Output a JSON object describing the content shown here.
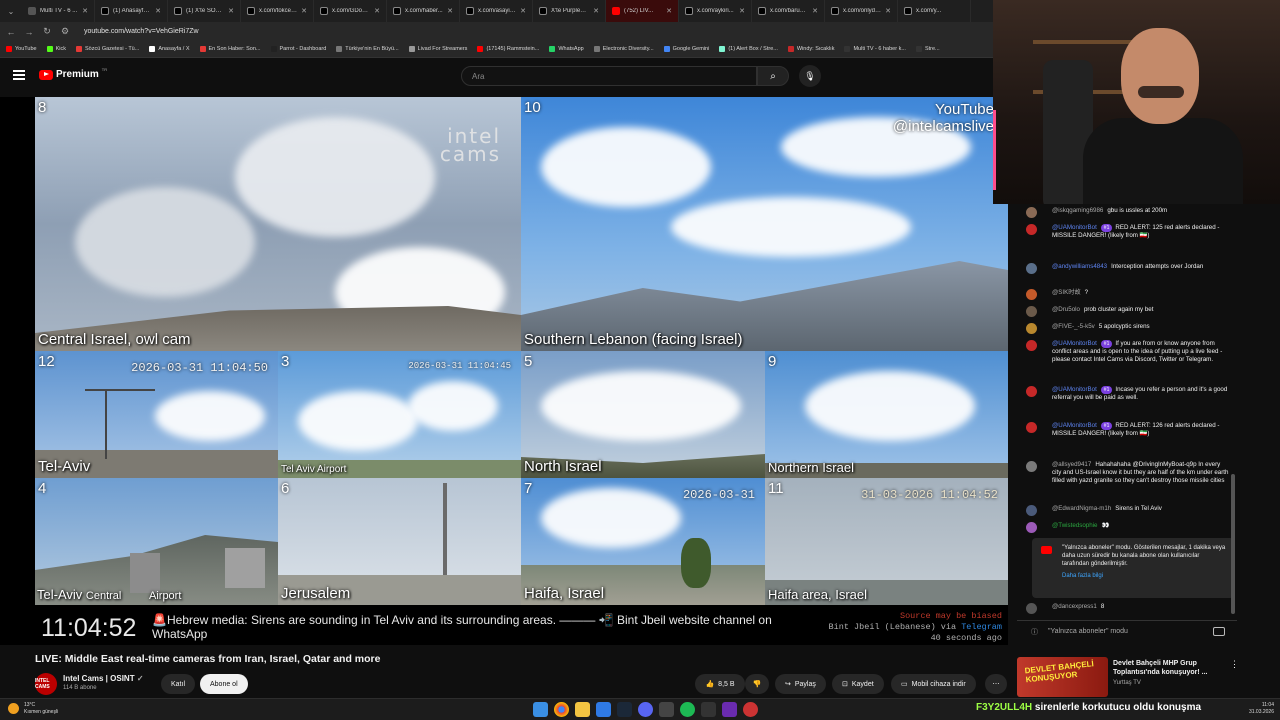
{
  "browser": {
    "tabs": [
      {
        "label": "Multi TV - 6 ..."
      },
      {
        "label": "(1) Anasayfa / X"
      },
      {
        "label": "(1) X'te SON ..."
      },
      {
        "label": "x.com/tokcen..."
      },
      {
        "label": "x.com/GDon..."
      },
      {
        "label": "x.com/haber..."
      },
      {
        "label": "x.com/asayis..."
      },
      {
        "label": "X'te PurpleBi..."
      },
      {
        "label": "(752) LIV..."
      },
      {
        "label": "x.com/aykiri..."
      },
      {
        "label": "x.com/barust..."
      },
      {
        "label": "x.com/onlydr..."
      },
      {
        "label": "x.com/y..."
      }
    ],
    "url": "youtube.com/watch?v=VehGieRi7Zw",
    "bookmarks": [
      "YouTube",
      "Kick",
      "Sözcü Gazetesi - Tü...",
      "Anasayfa / X",
      "En Son Haber: Son...",
      "Parrot - Dashboard",
      "Türkiye'nin En Büyü...",
      "Livad For Streamers",
      "(17145) Rammstein...",
      "WhatsApp",
      "Electronic Diversity...",
      "Google Gemini",
      "(1) Alert Box / Stre...",
      "Windy: Sıcaklık",
      "Multi TV - 6 haber k...",
      "Stre..."
    ]
  },
  "youtube": {
    "logo_text": "Premium",
    "logo_sup": "TR",
    "search_placeholder": "Ara"
  },
  "video": {
    "watermark_intel": "intel cams",
    "watermark_youtube_1": "YouTube",
    "watermark_youtube_2": "@intelcamslive",
    "cams": [
      {
        "num": "8",
        "label": "Central Israel, owl cam"
      },
      {
        "num": "10",
        "label": "Southern Lebanon (facing Israel)"
      },
      {
        "num": "12",
        "label": "Tel-Aviv",
        "ts": "2026-03-31 11:04:50"
      },
      {
        "num": "3",
        "label": "Tel Aviv Airport",
        "ts": "2026-03-31 11:04:45"
      },
      {
        "num": "5",
        "label": "North Israel"
      },
      {
        "num": "9",
        "label": "Northern Israel"
      },
      {
        "num": "4",
        "label": "Tel-Aviv",
        "label2": "Central",
        "label3": "Airport"
      },
      {
        "num": "6",
        "label": "Jerusalem"
      },
      {
        "num": "7",
        "label": "Haifa, Israel",
        "ts": "2026-03-31"
      },
      {
        "num": "11",
        "label": "Haifa area, Israel",
        "ts": "31-03-2026 11:04:52"
      }
    ],
    "clock": "11:04:52",
    "news": "🚨Hebrew media: Sirens are sounding in Tel Aviv and its surrounding areas. ——— 📲 Bint Jbeil website channel on WhatsApp",
    "source_1": "Source may be biased",
    "source_2": "Bint Jbeil (Lebanese) via",
    "source_2b": "Telegram",
    "source_3": "40 seconds ago"
  },
  "info": {
    "title": "LIVE: Middle East real-time cameras from Iran, Israel, Qatar and more",
    "channel": "Intel Cams | OSINT",
    "subs": "114 B abone",
    "join": "Katıl",
    "subscribe": "Abone ol",
    "likes": "8,5 B",
    "share": "Paylaş",
    "save": "Kaydet",
    "mobile": "Mobil cihaza indir",
    "avatar_text": "INTEL CAMS"
  },
  "chat": {
    "messages": [
      {
        "author": "@iskqgaming6986",
        "text": "gbu is ussles at 200m",
        "type": "normal",
        "color": "#8a6a55"
      },
      {
        "author": "@UAMonitorBot",
        "badge": "#1",
        "text": "RED ALERT: 125 red alerts declared - MISSILE DANGER! (likely from 🇮🇷)",
        "type": "mod",
        "color": "#c62828"
      },
      {
        "author": "@andywilliams4843",
        "text": "Interception attempts over Jordan",
        "type": "mod",
        "color": "#5a6f8a"
      },
      {
        "author": "@SIK时故",
        "text": "?",
        "type": "normal",
        "color": "#c45a2a"
      },
      {
        "author": "@Dru5olo",
        "text": "prob cluster again my bet",
        "type": "normal",
        "color": "#6b5a4a"
      },
      {
        "author": "@FIVE-_-5-k5v",
        "text": "5 apolcyptic sirens",
        "type": "normal",
        "color": "#b9882e"
      },
      {
        "author": "@UAMonitorBot",
        "badge": "#1",
        "text": "If you are from or know anyone from conflict areas and is open to the idea of putting up a live feed - please contact Intel Cams via Discord, Twitter or Telegram.",
        "type": "mod",
        "color": "#c62828"
      },
      {
        "author": "@UAMonitorBot",
        "badge": "#1",
        "text": "Incase you refer a person and it's a good referral you will be paid as well.",
        "type": "mod",
        "color": "#c62828"
      },
      {
        "author": "@UAMonitorBot",
        "badge": "#1",
        "text": "RED ALERT: 126 red alerts declared - MISSILE DANGER! (likely from 🇮🇷)",
        "type": "mod",
        "color": "#c62828"
      },
      {
        "author": "@allsyed9417",
        "text": "Hahahahaha @DrivingInMyBoat-q9p In every city and US-Israel know it but they are half of the km under earth filled with yazd granite so they can't destroy those missile cities",
        "type": "normal",
        "color": "#7a7a7a"
      },
      {
        "author": "@EdwardNigma-m1h",
        "text": "Sirens in Tel Aviv",
        "type": "normal",
        "color": "#4a5a7a"
      },
      {
        "author": "@Twistedsophie",
        "text": "👀",
        "type": "member",
        "color": "#9c5ab8"
      },
      {
        "author": "@dancexpress1",
        "text": "8",
        "type": "normal",
        "color": "#555555"
      }
    ],
    "notice": "\"Yalnızca aboneler\" modu. Gösterilen mesajlar, 1 dakika veya daha uzun süredir bu kanala abone olan kullanıcılar tarafından gönderilmiştir.",
    "notice_more": "Daha fazla bilgi",
    "input_mode": "\"Yalnızca aboneler\" modu"
  },
  "recommendation": {
    "thumb_text": "DEVLET BAHÇELİ KONUŞUYOR",
    "title": "Devlet Bahçeli MHP Grup Toplantısı'nda konuşuyor! ...",
    "channel": "Yurttaş TV"
  },
  "taskbar": {
    "temp": "13°C",
    "weather": "Kısmen güneşli",
    "ticker_hl": "F3Y2ULL4H",
    "ticker": "sirenlerle korkutucu oldu konuşma",
    "time": "11:04",
    "date": "31.03.2026"
  }
}
